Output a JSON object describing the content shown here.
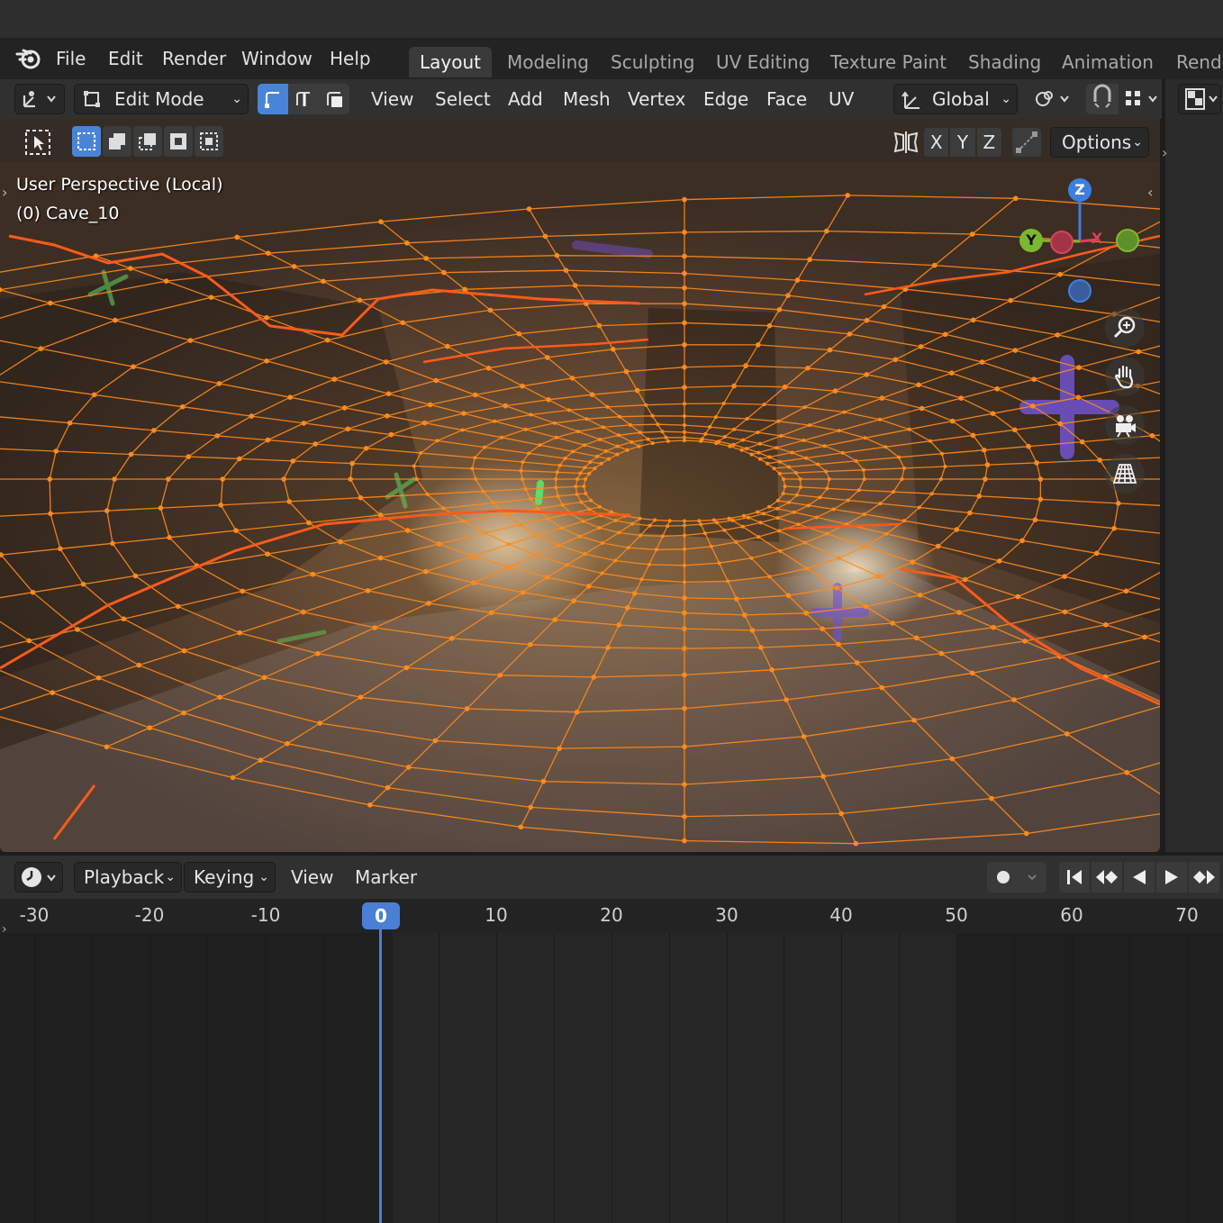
{
  "topbar": {
    "menus": [
      "File",
      "Edit",
      "Render",
      "Window",
      "Help"
    ],
    "workspace_tabs": [
      "Layout",
      "Modeling",
      "Sculpting",
      "UV Editing",
      "Texture Paint",
      "Shading",
      "Animation",
      "Rende"
    ],
    "active_tab": "Layout"
  },
  "viewport_header": {
    "mode": "Edit Mode",
    "menus": [
      "View",
      "Select",
      "Add",
      "Mesh",
      "Vertex",
      "Edge",
      "Face",
      "UV"
    ],
    "orientation": "Global",
    "select_modes": [
      "vertex",
      "edge",
      "face"
    ],
    "active_select_mode": "vertex"
  },
  "tool_header": {
    "axes": [
      "X",
      "Y",
      "Z"
    ],
    "options_label": "Options"
  },
  "viewport": {
    "perspective_label": "User Perspective (Local)",
    "object_label": "(0) Cave_10"
  },
  "gizmo": {
    "z": "Z",
    "y": "Y",
    "x": "X",
    "colors": {
      "z": "#3d7fe0",
      "y": "#7cb82f",
      "x": "#d9425c",
      "ny": "#5e8f2a",
      "nx": "#a33448",
      "nz": "#3a5d9c"
    }
  },
  "timeline": {
    "menus": [
      "Playback",
      "Keying",
      "View",
      "Marker"
    ],
    "current_frame": "0",
    "ticks": [
      "-30",
      "-20",
      "-10",
      "10",
      "20",
      "30",
      "40",
      "50",
      "60",
      "70"
    ],
    "playhead_color": "#4b7fd6"
  },
  "colors": {
    "wire": "#ff8a1c",
    "selected_edge": "#ff5a1a",
    "accent_blue": "#4a84d8"
  }
}
